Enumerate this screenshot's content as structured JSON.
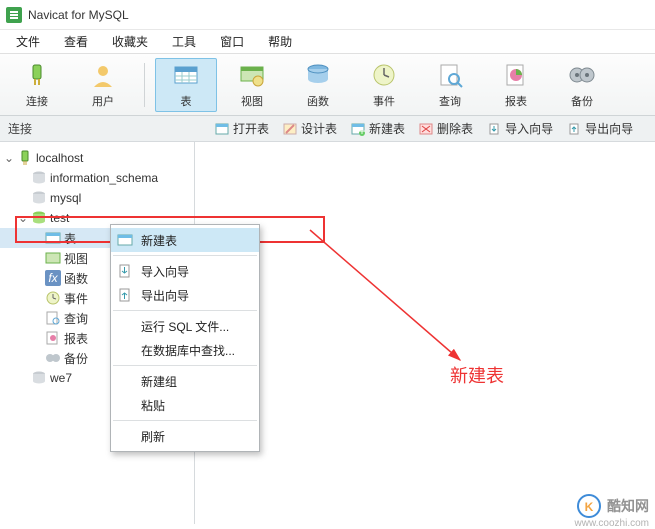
{
  "window": {
    "title": "Navicat for MySQL"
  },
  "menu": {
    "file": "文件",
    "view": "查看",
    "favorites": "收藏夹",
    "tools": "工具",
    "window": "窗口",
    "help": "帮助"
  },
  "toolbar": {
    "conn": "连接",
    "user": "用户",
    "table": "表",
    "view": "视图",
    "func": "函数",
    "event": "事件",
    "query": "查询",
    "report": "报表",
    "backup": "备份"
  },
  "subbar": {
    "label": "连接",
    "open": "打开表",
    "design": "设计表",
    "new": "新建表",
    "delete": "删除表",
    "import": "导入向导",
    "export": "导出向导"
  },
  "tree": {
    "host": "localhost",
    "db1": "information_schema",
    "db2": "mysql",
    "db3": "test",
    "n_table": "表",
    "n_view": "视图",
    "n_func": "函数",
    "n_event": "事件",
    "n_query": "查询",
    "n_report": "报表",
    "n_backup": "备份",
    "db4": "we7"
  },
  "ctx": {
    "new": "新建表",
    "import": "导入向导",
    "export": "导出向导",
    "runsql": "运行 SQL 文件...",
    "find": "在数据库中查找...",
    "group": "新建组",
    "paste": "粘贴",
    "refresh": "刷新"
  },
  "annotation": "新建表",
  "watermark": {
    "site": "酷知网",
    "url": "www.coozhi.com"
  }
}
